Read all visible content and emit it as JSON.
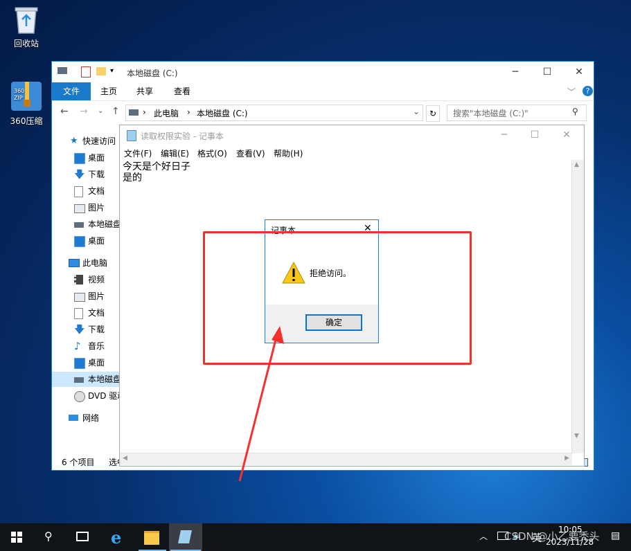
{
  "desktop": {
    "recycle_label": "回收站",
    "zip_label": "360压缩",
    "zip_icon_text": "360\nZIP"
  },
  "explorer": {
    "title": "本地磁盘 (C:)",
    "ribbon_tabs": [
      "文件",
      "主页",
      "共享",
      "查看"
    ],
    "breadcrumb": [
      "此电脑",
      "本地磁盘 (C:)"
    ],
    "search_placeholder": "搜索\"本地磁盘 (C:)\"",
    "nav_items": [
      {
        "label": "快速访问",
        "icon": "star-icon"
      },
      {
        "label": "桌面",
        "icon": "desktop-icon"
      },
      {
        "label": "下载",
        "icon": "download-icon"
      },
      {
        "label": "文档",
        "icon": "document-icon"
      },
      {
        "label": "图片",
        "icon": "picture-icon"
      },
      {
        "label": "本地磁盘",
        "icon": "drive-icon"
      },
      {
        "label": "桌面",
        "icon": "desktop-icon"
      },
      {
        "label": "此电脑",
        "icon": "computer-icon"
      },
      {
        "label": "视频",
        "icon": "video-icon"
      },
      {
        "label": "图片",
        "icon": "picture-icon"
      },
      {
        "label": "文档",
        "icon": "document-icon"
      },
      {
        "label": "下载",
        "icon": "download-icon"
      },
      {
        "label": "音乐",
        "icon": "music-icon"
      },
      {
        "label": "桌面",
        "icon": "desktop-icon"
      },
      {
        "label": "本地磁盘",
        "icon": "drive-icon"
      },
      {
        "label": "DVD 驱动",
        "icon": "dvd-icon"
      },
      {
        "label": "网络",
        "icon": "network-icon"
      }
    ],
    "status_count": "6 个项目",
    "status_selected": "选中"
  },
  "notepad": {
    "title": "读取权限实验 - 记事本",
    "menu": [
      "文件(F)",
      "编辑(E)",
      "格式(O)",
      "查看(V)",
      "帮助(H)"
    ],
    "content": "今天是个好日子\n是的"
  },
  "dialog": {
    "title": "记事本",
    "message": "拒绝访问。",
    "ok_label": "确定"
  },
  "taskbar": {
    "time": "10:05",
    "date": "2023/11/28",
    "ime": "英",
    "watermark": "CSDN @小乙要秃头"
  },
  "colors": {
    "accent": "#1979ca",
    "highlight": "#f5302a",
    "warning": "#f7c719"
  }
}
